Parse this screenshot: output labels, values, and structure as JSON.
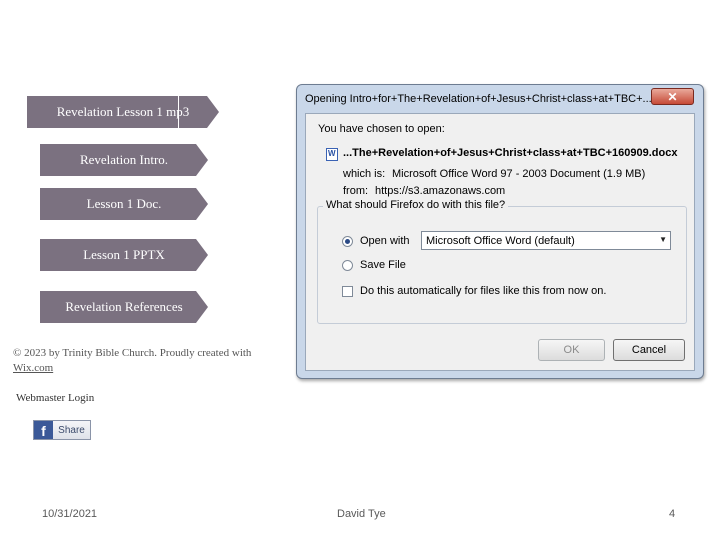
{
  "nav": {
    "item1_a": "Revelation Lesson 1 ",
    "item1_b": "mp3",
    "item2": "Revelation Intro.",
    "item3": "Lesson 1 Doc.",
    "item4": "Lesson 1 PPTX",
    "item5": "Revelation References"
  },
  "site_footer": {
    "copyright_text": "© 2023 by Trinity Bible Church. Proudly created with",
    "wix_link": "Wix.com",
    "webmaster_login": "Webmaster Login",
    "share_label": "Share",
    "fb_glyph": "f"
  },
  "dialog": {
    "title": "Opening Intro+for+The+Revelation+of+Jesus+Christ+class+at+TBC+...",
    "close_glyph": "✕",
    "chosen_label": "You have chosen to open:",
    "filename": "...The+Revelation+of+Jesus+Christ+class+at+TBC+160909.docx",
    "which_is_label": "which is:",
    "which_is_value": "Microsoft Office Word 97 - 2003 Document (1.9 MB)",
    "from_label": "from:",
    "from_value": "https://s3.amazonaws.com",
    "group_label": "What should Firefox do with this file?",
    "open_with_label": "Open with",
    "open_with_app": "Microsoft Office Word (default)",
    "save_file_label": "Save File",
    "auto_label": "Do this automatically for files like this from now on.",
    "ok_label": "OK",
    "cancel_label": "Cancel"
  },
  "slide_footer": {
    "date": "10/31/2021",
    "author": "David Tye",
    "page": "4"
  }
}
